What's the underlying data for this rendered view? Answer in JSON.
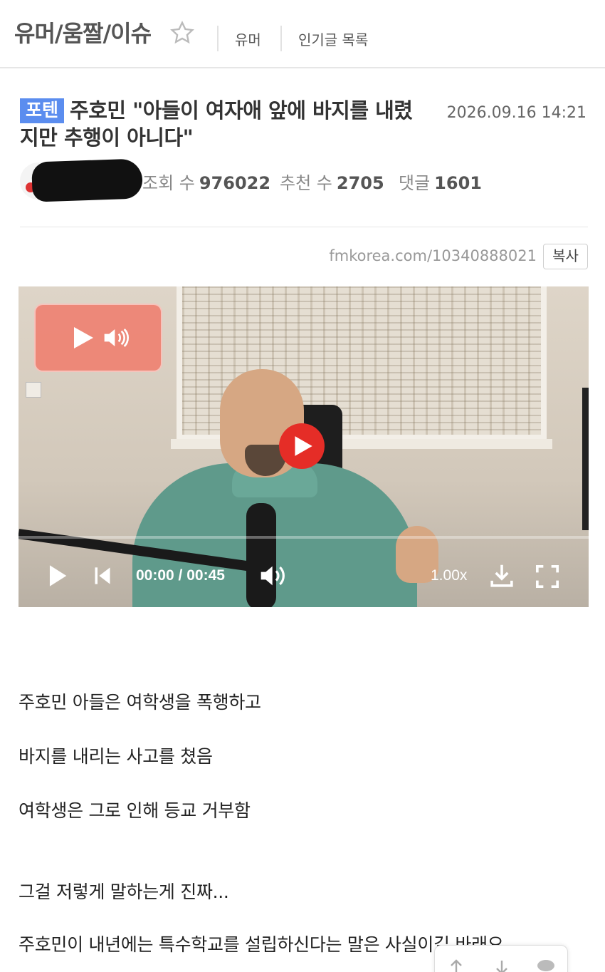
{
  "header": {
    "board_title": "유머/움짤/이슈",
    "links": [
      "유머",
      "인기글 목록"
    ]
  },
  "post": {
    "category": "포텐",
    "title": "주호민 \"아들이 여자애 앞에 바지를 내렸지만 추행이 아니다\"",
    "date": "2026.09.16 14:21",
    "views_label": "조회 수",
    "views": "976022",
    "recommend_label": "추천 수",
    "recommend": "2705",
    "comments_label": "댓글",
    "comments": "1601",
    "url": "fmkorea.com/10340888021",
    "copy_label": "복사"
  },
  "video": {
    "time": "00:00 / 00:45",
    "speed": "1.00x",
    "progress": 0
  },
  "body_lines": [
    "주호민 아들은 여학생을 폭행하고",
    "바지를 내리는 사고를 쳤음",
    "여학생은 그로 인해 등교 거부함",
    "그걸 저렇게 말하는게 진짜...",
    "주호민이 내년에는 특수학교를 설립하신다는 말은 사실이길 바래요"
  ],
  "colors": {
    "badge": "#5b8def",
    "play_red": "#e52d27",
    "overlay": "#ee8070"
  },
  "icons": [
    "star-icon",
    "play-icon",
    "volume-icon",
    "skip-back-icon",
    "download-icon",
    "fullscreen-icon",
    "arrow-up-icon",
    "arrow-down-icon",
    "comment-icon"
  ]
}
